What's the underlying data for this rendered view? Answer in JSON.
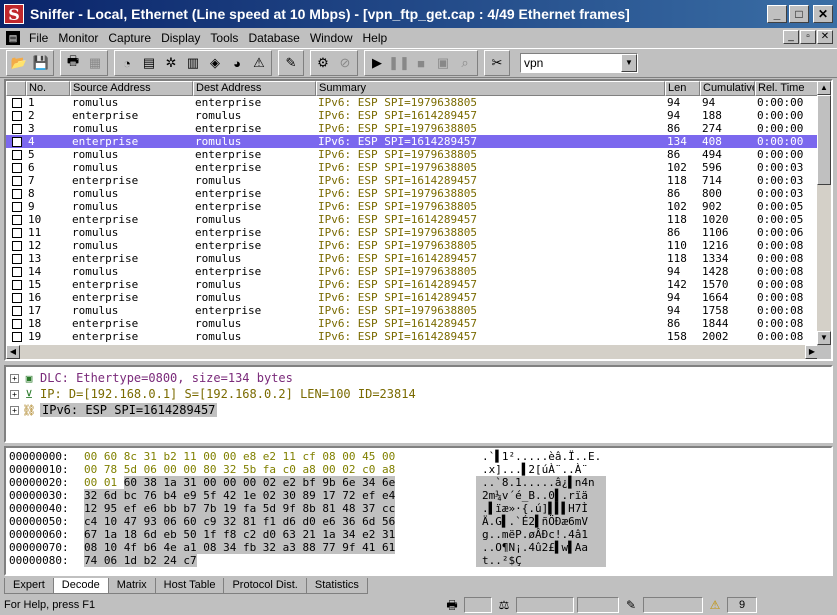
{
  "window": {
    "app_icon": "S",
    "title": "Sniffer - Local, Ethernet (Line speed at 10 Mbps) - [vpn_ftp_get.cap : 4/49 Ethernet frames]",
    "buttons": {
      "minimize": "_",
      "maximize": "□",
      "close": "✕"
    }
  },
  "menu": {
    "items": [
      "File",
      "Monitor",
      "Capture",
      "Display",
      "Tools",
      "Database",
      "Window",
      "Help"
    ]
  },
  "toolbar": {
    "filter_value": "vpn",
    "icons": [
      "open-icon",
      "save-icon",
      "print-icon",
      "print-preview-icon",
      "dashboard-icon",
      "host-table-icon",
      "matrix-icon",
      "application-response-icon",
      "history-icon",
      "protocol-dist-icon",
      "alarm-icon",
      "filter-icon",
      "capture-settings-icon",
      "stop-icon",
      "start-capture-icon",
      "pause-icon",
      "stop-capture-icon",
      "stop-display-icon",
      "display-icon",
      "find-icon",
      "expert-icon"
    ]
  },
  "summary": {
    "columns": [
      "No.",
      "Source Address",
      "Dest Address",
      "Summary",
      "Len",
      "Cumulative",
      "Rel. Time"
    ],
    "rows": [
      {
        "no": "1",
        "src": "romulus",
        "dst": "enterprise",
        "summary": "IPv6: ESP SPI=1979638805",
        "len": "94",
        "cum": "94",
        "rel": "0:00:00"
      },
      {
        "no": "2",
        "src": "enterprise",
        "dst": "romulus",
        "summary": "IPv6: ESP SPI=1614289457",
        "len": "94",
        "cum": "188",
        "rel": "0:00:00"
      },
      {
        "no": "3",
        "src": "romulus",
        "dst": "enterprise",
        "summary": "IPv6: ESP SPI=1979638805",
        "len": "86",
        "cum": "274",
        "rel": "0:00:00"
      },
      {
        "no": "4",
        "src": "enterprise",
        "dst": "romulus",
        "summary": "IPv6: ESP SPI=1614289457",
        "len": "134",
        "cum": "408",
        "rel": "0:00:00",
        "selected": true
      },
      {
        "no": "5",
        "src": "romulus",
        "dst": "enterprise",
        "summary": "IPv6: ESP SPI=1979638805",
        "len": "86",
        "cum": "494",
        "rel": "0:00:00"
      },
      {
        "no": "6",
        "src": "romulus",
        "dst": "enterprise",
        "summary": "IPv6: ESP SPI=1979638805",
        "len": "102",
        "cum": "596",
        "rel": "0:00:03"
      },
      {
        "no": "7",
        "src": "enterprise",
        "dst": "romulus",
        "summary": "IPv6: ESP SPI=1614289457",
        "len": "118",
        "cum": "714",
        "rel": "0:00:03"
      },
      {
        "no": "8",
        "src": "romulus",
        "dst": "enterprise",
        "summary": "IPv6: ESP SPI=1979638805",
        "len": "86",
        "cum": "800",
        "rel": "0:00:03"
      },
      {
        "no": "9",
        "src": "romulus",
        "dst": "enterprise",
        "summary": "IPv6: ESP SPI=1979638805",
        "len": "102",
        "cum": "902",
        "rel": "0:00:05"
      },
      {
        "no": "10",
        "src": "enterprise",
        "dst": "romulus",
        "summary": "IPv6: ESP SPI=1614289457",
        "len": "118",
        "cum": "1020",
        "rel": "0:00:05"
      },
      {
        "no": "11",
        "src": "romulus",
        "dst": "enterprise",
        "summary": "IPv6: ESP SPI=1979638805",
        "len": "86",
        "cum": "1106",
        "rel": "0:00:06"
      },
      {
        "no": "12",
        "src": "romulus",
        "dst": "enterprise",
        "summary": "IPv6: ESP SPI=1979638805",
        "len": "110",
        "cum": "1216",
        "rel": "0:00:08"
      },
      {
        "no": "13",
        "src": "enterprise",
        "dst": "romulus",
        "summary": "IPv6: ESP SPI=1614289457",
        "len": "118",
        "cum": "1334",
        "rel": "0:00:08"
      },
      {
        "no": "14",
        "src": "romulus",
        "dst": "enterprise",
        "summary": "IPv6: ESP SPI=1979638805",
        "len": "94",
        "cum": "1428",
        "rel": "0:00:08"
      },
      {
        "no": "15",
        "src": "enterprise",
        "dst": "romulus",
        "summary": "IPv6: ESP SPI=1614289457",
        "len": "142",
        "cum": "1570",
        "rel": "0:00:08"
      },
      {
        "no": "16",
        "src": "enterprise",
        "dst": "romulus",
        "summary": "IPv6: ESP SPI=1614289457",
        "len": "94",
        "cum": "1664",
        "rel": "0:00:08"
      },
      {
        "no": "17",
        "src": "romulus",
        "dst": "enterprise",
        "summary": "IPv6: ESP SPI=1979638805",
        "len": "94",
        "cum": "1758",
        "rel": "0:00:08"
      },
      {
        "no": "18",
        "src": "enterprise",
        "dst": "romulus",
        "summary": "IPv6: ESP SPI=1614289457",
        "len": "86",
        "cum": "1844",
        "rel": "0:00:08"
      },
      {
        "no": "19",
        "src": "enterprise",
        "dst": "romulus",
        "summary": "IPv6: ESP SPI=1614289457",
        "len": "158",
        "cum": "2002",
        "rel": "0:00:08"
      }
    ]
  },
  "decode": {
    "nodes": [
      {
        "label": "DLC: Ethertype=0800, size=134 bytes",
        "icon": "dlc-icon",
        "style": "dlc"
      },
      {
        "label": "IP:  D=[192.168.0.1] S=[192.168.0.2] LEN=100 ID=23814",
        "icon": "ip-icon",
        "style": "ip"
      },
      {
        "label": "IPv6: ESP SPI=1614289457",
        "icon": "ipv6-icon",
        "style": "ipv6"
      }
    ]
  },
  "hex": {
    "rows": [
      {
        "offset": "00000000:",
        "bytes_g": "00 60 8c 31 b2 11 00 00 e8 e2 11 cf 08 00 45 00",
        "bytes_p": "",
        "ascii": ".`▌1².....èâ.Ï..E."
      },
      {
        "offset": "00000010:",
        "bytes_g": "00 78 5d 06 00 00 80 32 5b fa c0 a8 00 02 c0 a8",
        "bytes_p": "",
        "ascii": ".x]...▌2[úÀ¨..À¨"
      },
      {
        "offset": "00000020:",
        "bytes_g": "00 01 ",
        "bytes_p": "60 38 1a 31 00 00 00 02 e2 bf 9b 6e 34 6e",
        "ascii": "..`8.1.....â¿▌n4n"
      },
      {
        "offset": "00000030:",
        "bytes_g": "",
        "bytes_p": "32 6d bc 76 b4 e9 5f 42 1e 02 30 89 17 72 ef e4",
        "ascii": "2m¼v´é_B..0▌.rïä"
      },
      {
        "offset": "00000040:",
        "bytes_g": "",
        "bytes_p": "12 95 ef e6 bb b7 7b 19 fa 5d 9f 8b 81 48 37 cc",
        "ascii": ".▌ïæ»·{.ú]▌▌▌H7Ì"
      },
      {
        "offset": "00000050:",
        "bytes_g": "",
        "bytes_p": "c4 10 47 93 06 60 c9 32 81 f1 d6 d0 e6 36 6d 56",
        "ascii": "Ä.G▌.`É2▌ñÖÐæ6mV"
      },
      {
        "offset": "00000060:",
        "bytes_g": "",
        "bytes_p": "67 1a 18 6d eb 50 1f f8 c2 d0 63 21 1a 34 e2 31",
        "ascii": "g..mëP.øÂÐc!.4â1"
      },
      {
        "offset": "00000070:",
        "bytes_g": "",
        "bytes_p": "08 10 4f b6 4e a1 08 34 fb 32 a3 88 77 9f 41 61",
        "ascii": "..O¶N¡.4û2£▌w▌Aa"
      },
      {
        "offset": "00000080:",
        "bytes_g": "",
        "bytes_p": "74 06 1d b2 24 c7",
        "ascii": "t..²$Ç"
      }
    ]
  },
  "tabs": [
    "Expert",
    "Decode",
    "Matrix",
    "Host Table",
    "Protocol Dist.",
    "Statistics"
  ],
  "active_tab": "Decode",
  "status": {
    "help_text": "For Help, press F1",
    "alarm_count": "9"
  },
  "colors": {
    "title_gradient_start": "#0a246a",
    "selection": "#7b68ee",
    "summary_text": "#7a6a00"
  }
}
